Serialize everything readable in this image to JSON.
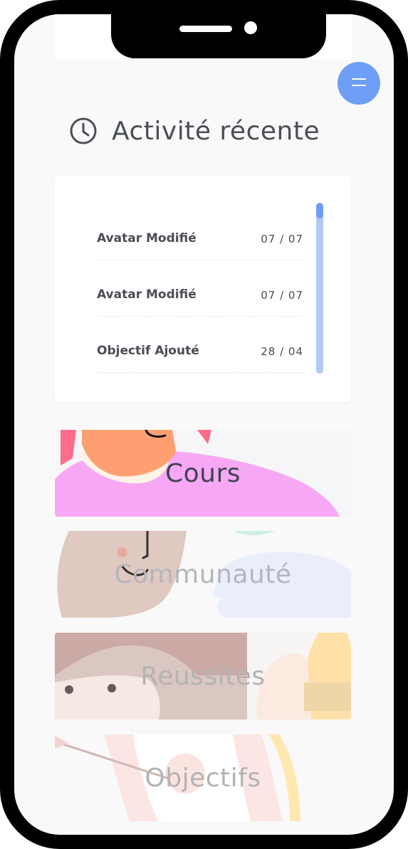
{
  "header": {
    "title": "Activité récente",
    "icon": "clock-icon"
  },
  "menu": {
    "icon": "menu-icon",
    "color": "#6e9ef5"
  },
  "activity": {
    "items": [
      {
        "label": "Avatar Modifié",
        "date": "07 / 07"
      },
      {
        "label": "Avatar Modifié",
        "date": "07 / 07"
      },
      {
        "label": "Objectif Ajouté",
        "date": "28 / 04"
      }
    ]
  },
  "sections": [
    {
      "label": "Cours"
    },
    {
      "label": "Communauté"
    },
    {
      "label": "Reussites"
    },
    {
      "label": "Objectifs"
    }
  ],
  "colors": {
    "accent": "#6e9ef5",
    "text": "#4a4d55",
    "scrollbar_track": "#b2c8f6"
  }
}
